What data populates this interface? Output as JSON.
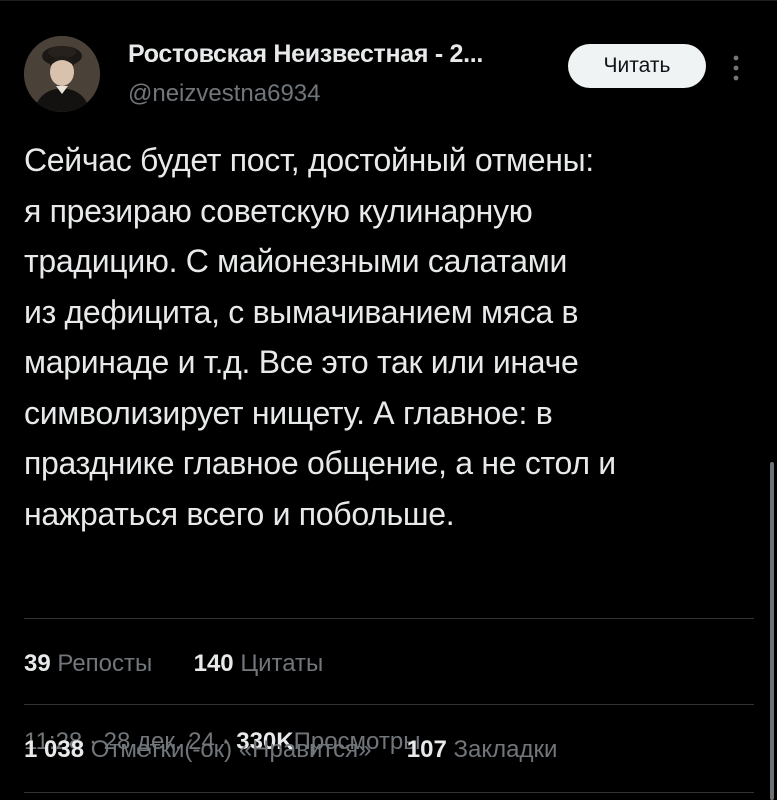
{
  "author": {
    "name": "Ростовская Неизвестная - 2...",
    "handle": "@neizvestna6934"
  },
  "follow_button": "Читать",
  "post": {
    "lines": [
      "Сейчас будет пост, достойный отмены:",
      "я презираю советскую кулинарную",
      "традицию. С майонезными салатами",
      "из дефицита, с вымачиванием мяса в",
      "маринаде и т.д. Все это так или иначе",
      "символизирует нищету. А главное: в",
      "празднике главное общение, а не стол и",
      "нажраться всего и побольше."
    ]
  },
  "meta": {
    "time": "11:28",
    "date": "28 дек. 24",
    "separator": "·",
    "views_count": "330K",
    "views_label": "Просмотры"
  },
  "stats": {
    "reposts_count": "39",
    "reposts_label": "Репосты",
    "quotes_count": "140",
    "quotes_label": "Цитаты",
    "likes_count": "1 038",
    "likes_label": "Отметки(-ок) «Нравится»",
    "bookmarks_count": "107",
    "bookmarks_label": "Закладки"
  },
  "icons": {
    "more": "more-vertical-icon"
  },
  "colors": {
    "background": "#000000",
    "text": "#e7e9ea",
    "secondary": "#71767b",
    "divider": "#2f3336",
    "button_bg": "#eff3f4",
    "button_text": "#0f1419"
  }
}
